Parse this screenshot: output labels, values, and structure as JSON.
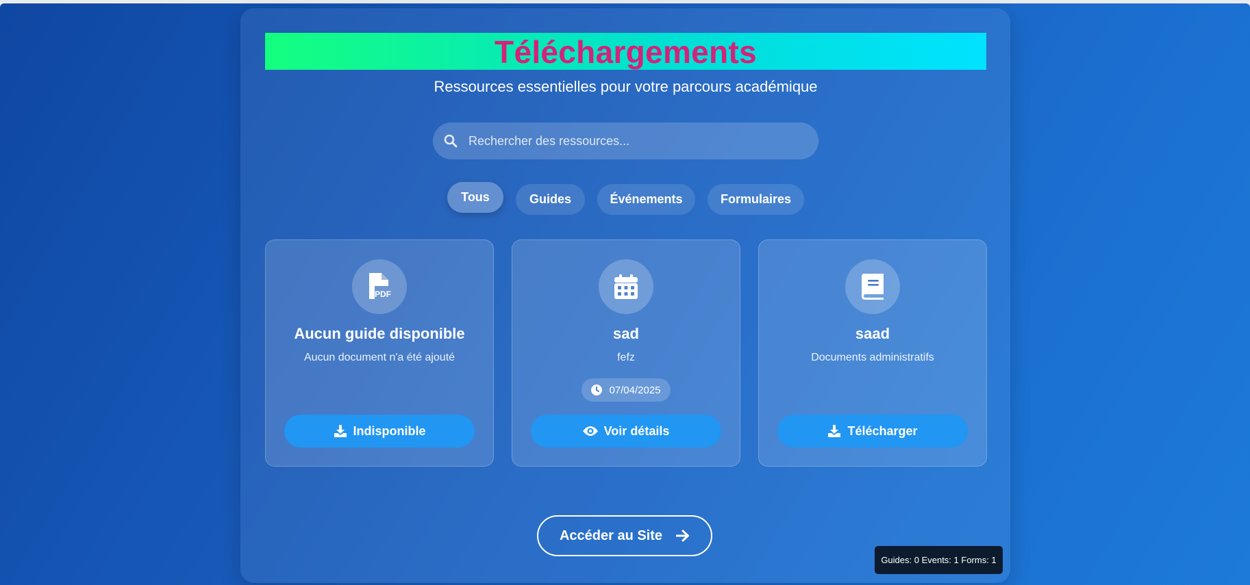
{
  "header": {
    "title": "Téléchargements",
    "subtitle": "Ressources essentielles pour votre parcours académique"
  },
  "search": {
    "placeholder": "Rechercher des ressources...",
    "icon": "search-icon"
  },
  "filters": [
    {
      "label": "Tous",
      "active": true
    },
    {
      "label": "Guides",
      "active": false
    },
    {
      "label": "Événements",
      "active": false
    },
    {
      "label": "Formulaires",
      "active": false
    }
  ],
  "cards": [
    {
      "icon": "file-pdf-icon",
      "title": "Aucun guide disponible",
      "description": "Aucun document n'a été ajouté",
      "button_icon": "download-icon",
      "button_label": "Indisponible"
    },
    {
      "icon": "calendar-icon",
      "title": "sad",
      "description": "fefz",
      "date_icon": "clock-icon",
      "date": "07/04/2025",
      "button_icon": "eye-icon",
      "button_label": "Voir détails"
    },
    {
      "icon": "book-icon",
      "title": "saad",
      "description": "Documents administratifs",
      "button_icon": "download-icon",
      "button_label": "Télécharger"
    }
  ],
  "site_button": {
    "label": "Accéder au Site",
    "icon": "arrow-right-icon"
  },
  "debug_badge": {
    "text": "Guides: 0 Events: 1 Forms: 1"
  },
  "colors": {
    "title": "#d6217a",
    "accent_button": "#2196f3",
    "background": "#1a5fbf"
  }
}
